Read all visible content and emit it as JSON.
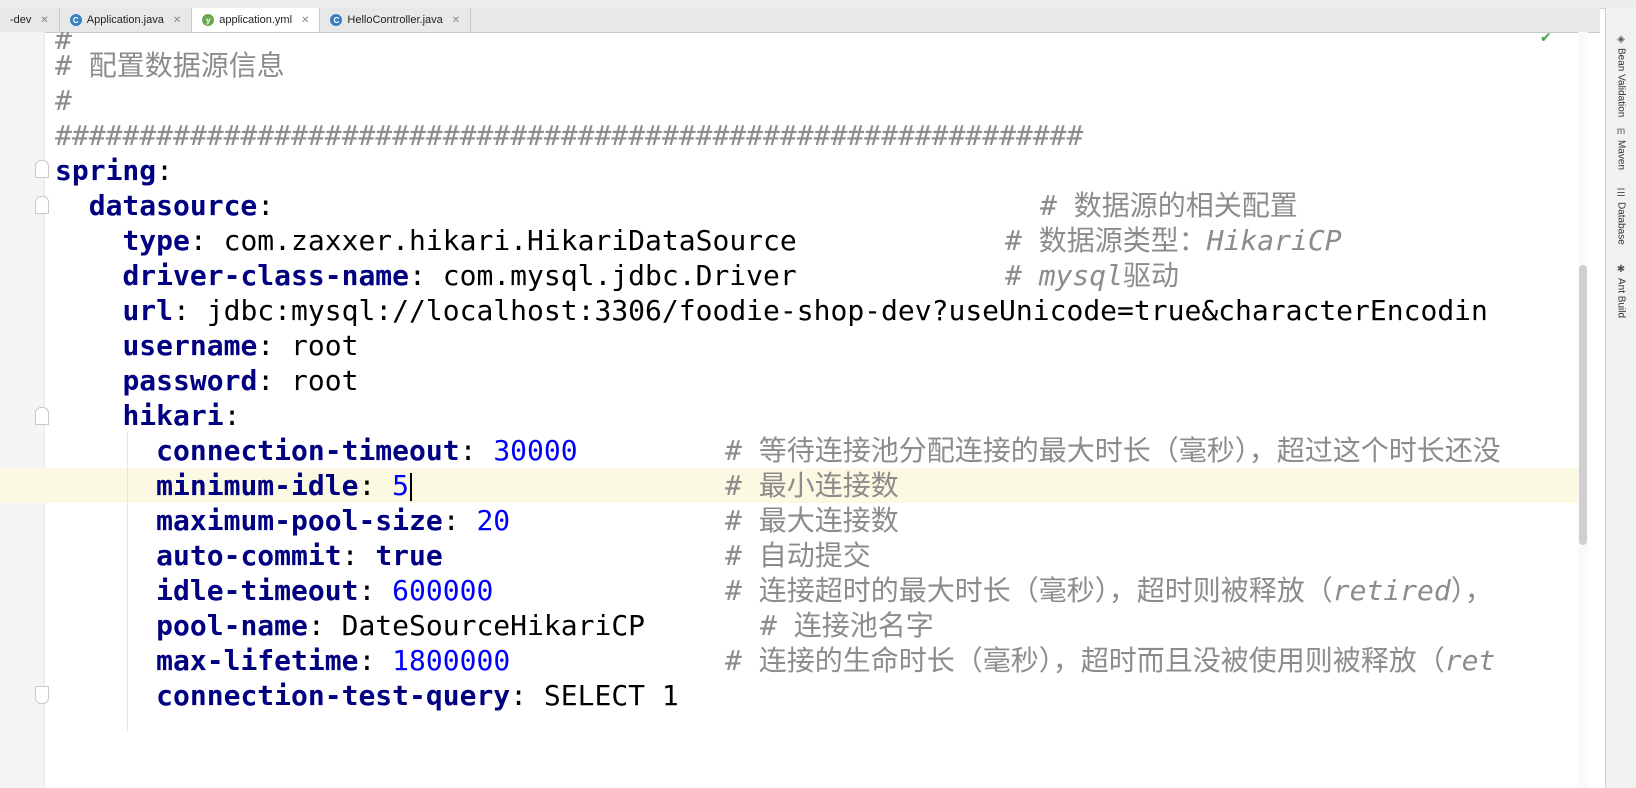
{
  "tabs": [
    {
      "label": "-dev",
      "icon": "none",
      "active": false
    },
    {
      "label": "Application.java",
      "icon": "java-class-icon",
      "active": false
    },
    {
      "label": "application.yml",
      "icon": "yaml-file-icon",
      "active": true
    },
    {
      "label": "HelloController.java",
      "icon": "java-class-icon",
      "active": false
    }
  ],
  "side_tools": [
    "Bean Validation",
    "Maven",
    "Database",
    "Ant Build"
  ],
  "editor": {
    "comment_hash": "#",
    "comment_title": "# 配置数据源信息",
    "hash_line": "#############################################################",
    "spring_key": "spring",
    "datasource_key": "datasource",
    "datasource_comment": "# 数据源的相关配置",
    "type_key": "type",
    "type_value": "com.zaxxer.hikari.HikariDataSource",
    "type_comment_prefix": "# 数据源类型：",
    "type_comment_italic": "HikariCP",
    "driver_key": "driver-class-name",
    "driver_value": "com.mysql.jdbc.Driver",
    "driver_comment_prefix": "# ",
    "driver_comment_italic": "mysql",
    "driver_comment_suffix": "驱动",
    "url_key": "url",
    "url_value": "jdbc:mysql://localhost:3306/foodie-shop-dev?useUnicode=true&characterEncodin",
    "username_key": "username",
    "username_value": "root",
    "password_key": "password",
    "password_value": "root",
    "hikari_key": "hikari",
    "ct_key": "connection-timeout",
    "ct_value": "30000",
    "ct_comment": "# 等待连接池分配连接的最大时长（毫秒），超过这个时长还没",
    "mi_key": "minimum-idle",
    "mi_value": "5",
    "mi_comment": "# 最小连接数",
    "mps_key": "maximum-pool-size",
    "mps_value": "20",
    "mps_comment": "# 最大连接数",
    "ac_key": "auto-commit",
    "ac_value": "true",
    "ac_comment": "# 自动提交",
    "it_key": "idle-timeout",
    "it_value": "600000",
    "it_comment_prefix": "# 连接超时的最大时长（毫秒），超时则被释放（",
    "it_comment_italic": "retired",
    "it_comment_suffix": "），",
    "pn_key": "pool-name",
    "pn_value": "DateSourceHikariCP",
    "pn_comment": "# 连接池名字",
    "ml_key": "max-lifetime",
    "ml_value": "1800000",
    "ml_comment_prefix": "# 连接的生命时长（毫秒），超时而且没被使用则被释放（",
    "ml_comment_italic": "ret",
    "ctq_key": "connection-test-query",
    "ctq_value": "SELECT 1",
    "colon": ":"
  },
  "colors": {
    "key": "#000080",
    "number": "#0000ff",
    "comment": "#8c8c8c",
    "current_line": "#fcf9e2"
  }
}
